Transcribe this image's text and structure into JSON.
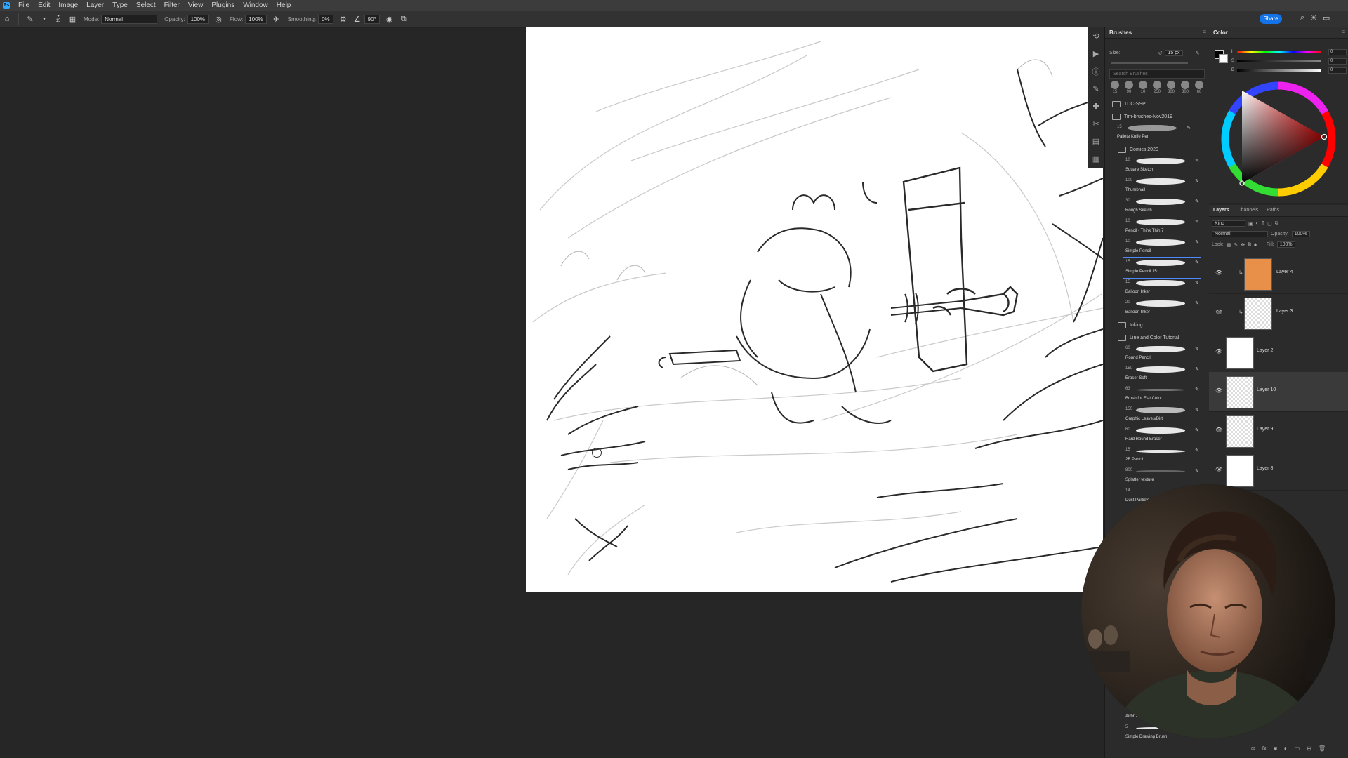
{
  "menu": [
    "File",
    "Edit",
    "Image",
    "Layer",
    "Type",
    "Select",
    "Filter",
    "View",
    "Plugins",
    "Window",
    "Help"
  ],
  "app_logo": "Ps",
  "options": {
    "brush_size": "15",
    "mode_label": "Mode:",
    "mode_value": "Normal",
    "opacity_label": "Opacity:",
    "opacity_value": "100%",
    "flow_label": "Flow:",
    "flow_value": "100%",
    "smoothing_label": "Smoothing:",
    "smoothing_value": "0%",
    "angle_value": "90°"
  },
  "share_label": "Share",
  "brushes_panel": {
    "title": "Brushes",
    "size_label": "Size:",
    "size_value": "15 px",
    "search_placeholder": "Search Brushes",
    "presets": [
      "15",
      "90",
      "10",
      "250",
      "300",
      "300",
      "60"
    ],
    "groups": [
      {
        "label": "TDC-SSP"
      },
      {
        "label": "Tim-brushes-Nov2019"
      }
    ],
    "top_item": {
      "size": "15",
      "name": "Pallete Knife Pen"
    },
    "comics_group": "Comics 2020",
    "items": [
      {
        "size": "10",
        "name": "Square Sketch"
      },
      {
        "size": "100",
        "name": "Thumbnail"
      },
      {
        "size": "30",
        "name": "Rough Sketch"
      },
      {
        "size": "10",
        "name": "Pencil - Think Thin 7"
      },
      {
        "size": "10",
        "name": "Simple Pencil"
      },
      {
        "size": "15",
        "name": "Simple Pencil 15"
      },
      {
        "size": "15",
        "name": "Balloon Inker"
      },
      {
        "size": "20",
        "name": "Balloon Inker"
      }
    ],
    "inking_group": "Inking",
    "line_group": "Line and Color Tutorial",
    "items2": [
      {
        "size": "60",
        "name": "Round Pencil"
      },
      {
        "size": "150",
        "name": "Eraser Soft"
      },
      {
        "size": "63",
        "name": "Brush for Flat Color"
      },
      {
        "size": "150",
        "name": "Graphic Leaves/Dirt"
      },
      {
        "size": "60",
        "name": "Hard Round Eraser"
      },
      {
        "size": "15",
        "name": "2B Pencil"
      },
      {
        "size": "800",
        "name": "Splatter texture"
      },
      {
        "size": "14",
        "name": "Dust Particles"
      }
    ],
    "bottom_items": [
      {
        "size": "75",
        "name": "Airbrush"
      },
      {
        "size": "5",
        "name": "Simple Drawing Brush"
      }
    ]
  },
  "color_panel": {
    "title": "Color",
    "h_label": "H",
    "s_label": "S",
    "b_label": "B",
    "h_value": "0",
    "s_value": "0",
    "b_value": "0",
    "h_unit": "°",
    "s_unit": "%",
    "b_unit": "%"
  },
  "layers_panel": {
    "tabs": [
      "Layers",
      "Channels",
      "Paths"
    ],
    "kind_label": "Kind",
    "blend_mode": "Normal",
    "opacity_label": "Opacity:",
    "opacity_value": "100%",
    "lock_label": "Lock:",
    "fill_label": "Fill:",
    "fill_value": "100%",
    "layers": [
      {
        "name": "Layer 4",
        "thumb": "orange",
        "clipped": true,
        "selected": false
      },
      {
        "name": "Layer 3",
        "thumb": "check",
        "clipped": true,
        "selected": false
      },
      {
        "name": "Layer 2",
        "thumb": "white",
        "clipped": false,
        "selected": false
      },
      {
        "name": "Layer 10",
        "thumb": "sketch",
        "clipped": false,
        "selected": true
      },
      {
        "name": "Layer 9",
        "thumb": "sketch",
        "clipped": false,
        "selected": false
      },
      {
        "name": "Layer 8",
        "thumb": "white",
        "clipped": false,
        "selected": false
      }
    ]
  },
  "colors": {
    "accent": "#1473e6",
    "layer4_thumb": "#e8904a",
    "selection": "#4a8cff"
  },
  "icons": {
    "home": "home-icon",
    "brush": "brush-icon",
    "eye": "eye-icon",
    "search": "search-icon"
  }
}
